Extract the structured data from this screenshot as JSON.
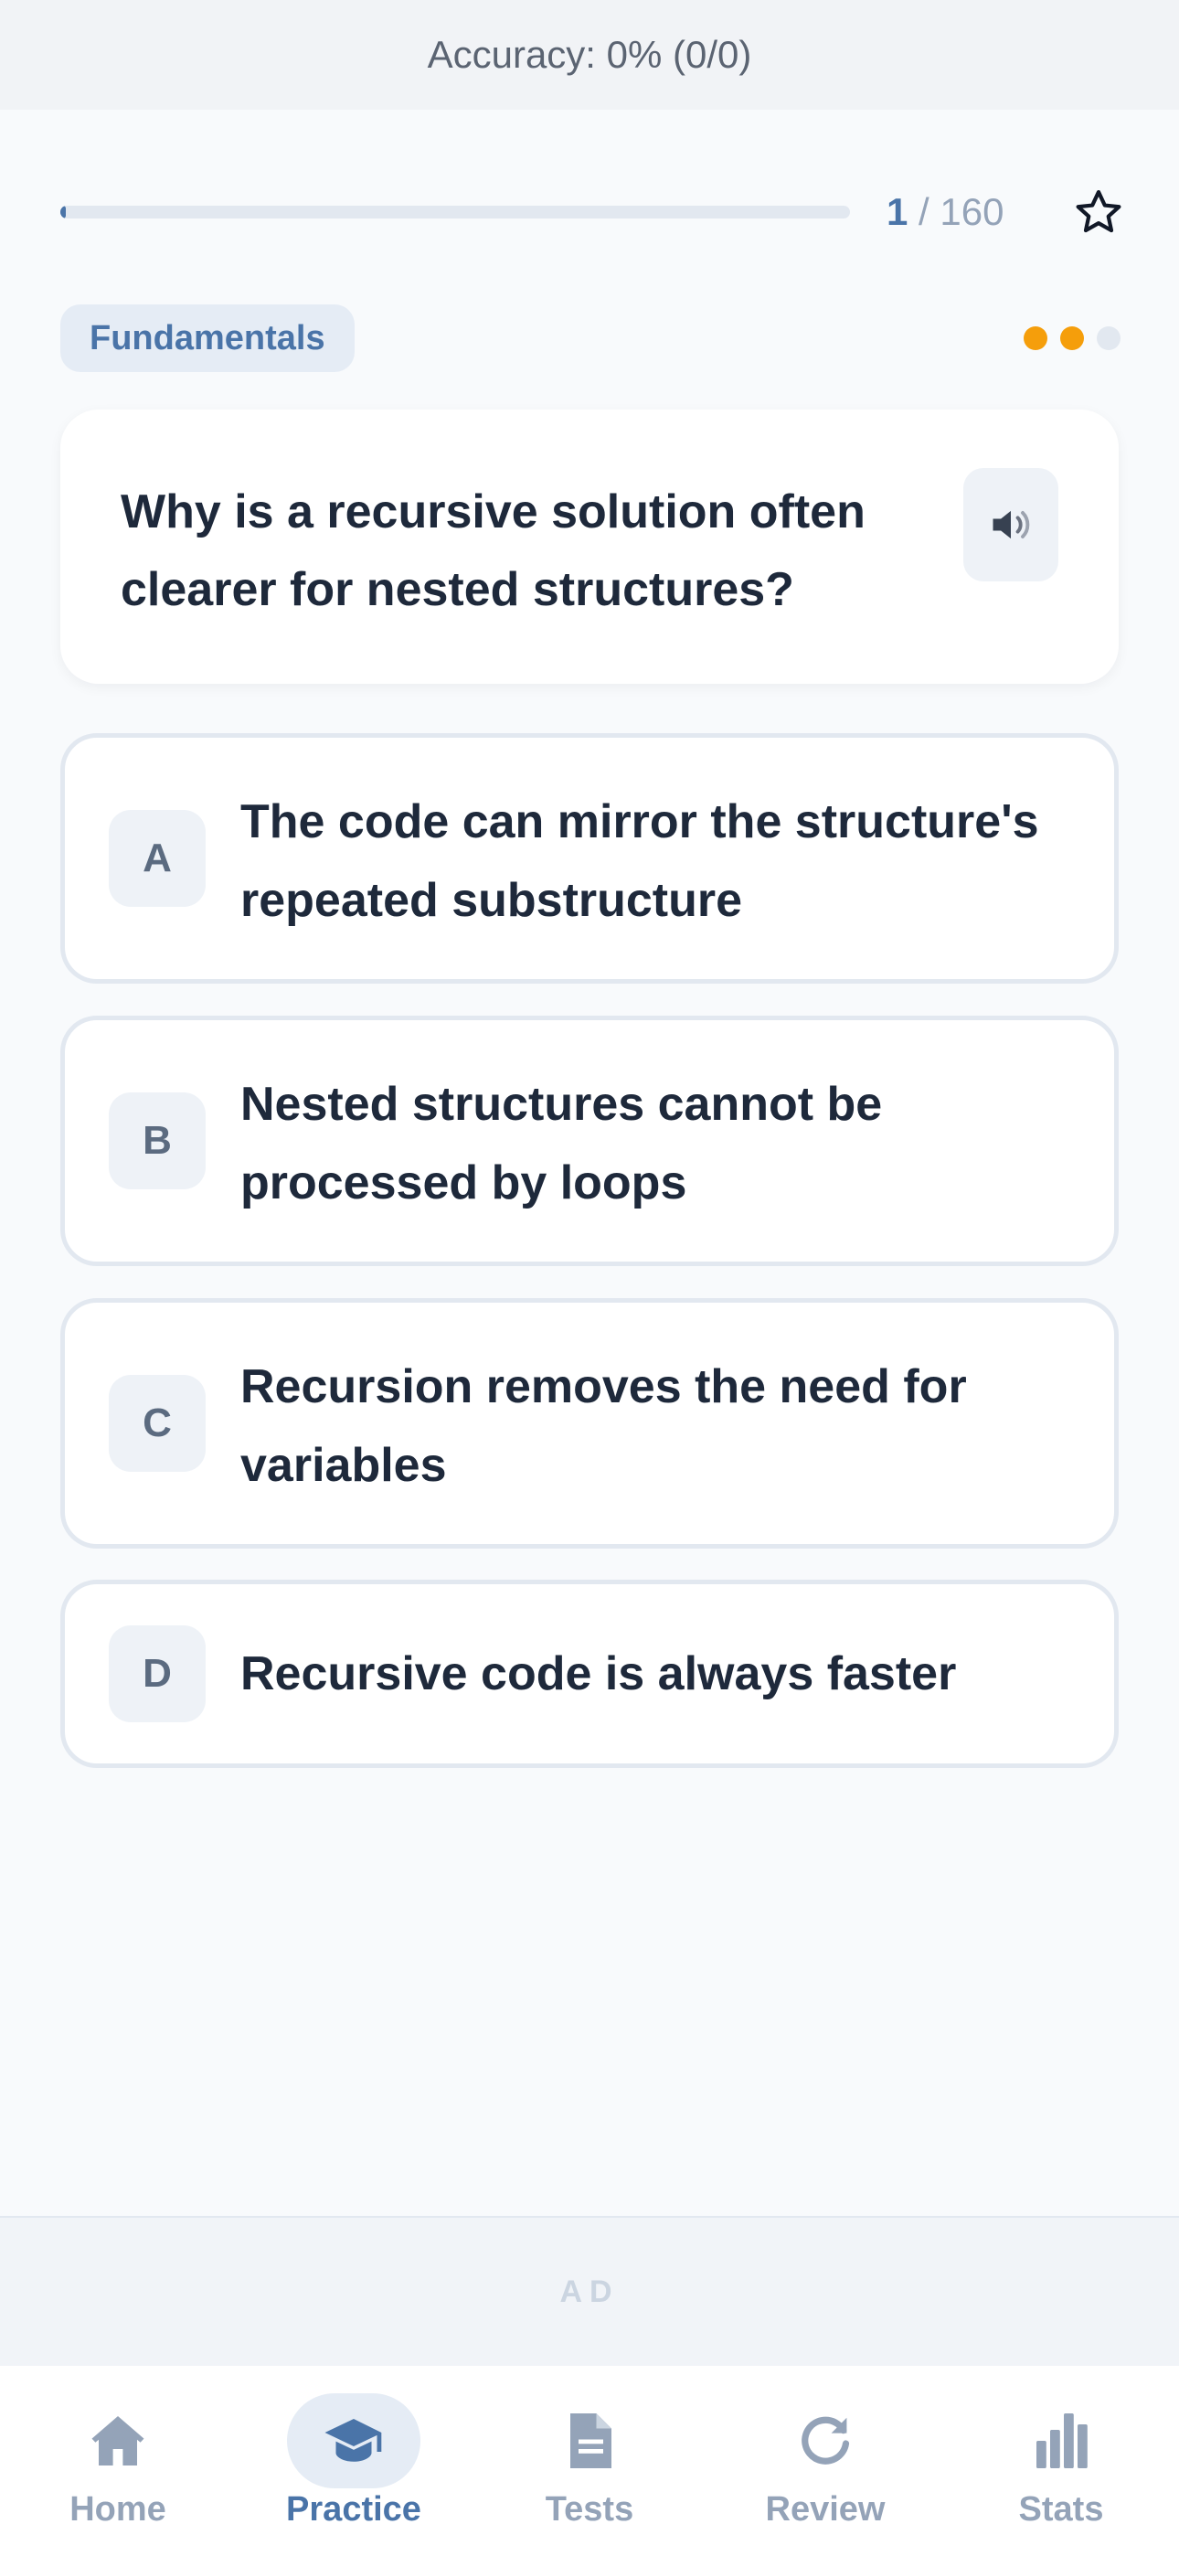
{
  "header": {
    "accuracy_text": "Accuracy: 0% (0/0)"
  },
  "progress": {
    "current": "1",
    "total_text": " / 160",
    "fraction": 0.00625
  },
  "question": {
    "category": "Fundamentals",
    "difficulty_filled": 2,
    "difficulty_total": 3,
    "text": "Why is a recursive solution often clearer for nested structures?"
  },
  "options": [
    {
      "letter": "A",
      "text": "The code can mirror the structure's repeated substructure"
    },
    {
      "letter": "B",
      "text": "Nested structures cannot be processed by loops"
    },
    {
      "letter": "C",
      "text": "Recursion removes the need for variables"
    },
    {
      "letter": "D",
      "text": "Recursive code is always faster"
    }
  ],
  "ad": {
    "label": "AD"
  },
  "nav": [
    {
      "label": "Home",
      "icon": "home-icon",
      "active": false
    },
    {
      "label": "Practice",
      "icon": "graduation-cap-icon",
      "active": true
    },
    {
      "label": "Tests",
      "icon": "document-icon",
      "active": false
    },
    {
      "label": "Review",
      "icon": "refresh-icon",
      "active": false
    },
    {
      "label": "Stats",
      "icon": "bar-chart-icon",
      "active": false
    }
  ],
  "colors": {
    "accent": "#4a74a8",
    "difficulty_on": "#f59e0b",
    "difficulty_off": "#e2e8f0",
    "inactive_nav": "#94a3b8"
  }
}
